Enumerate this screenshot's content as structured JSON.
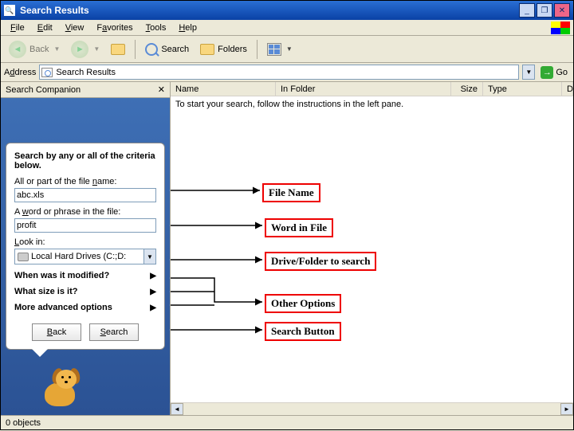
{
  "window": {
    "title": "Search Results"
  },
  "menu": {
    "file": "File",
    "edit": "Edit",
    "view": "View",
    "favorites": "Favorites",
    "tools": "Tools",
    "help": "Help"
  },
  "toolbar": {
    "back": "Back",
    "search": "Search",
    "folders": "Folders"
  },
  "address": {
    "label": "Address",
    "value": "Search Results",
    "go": "Go"
  },
  "companion": {
    "header": "Search Companion",
    "heading": "Search by any or all of the criteria below.",
    "filename_label": "All or part of the file name:",
    "filename_value": "abc.xls",
    "phrase_label": "A word or phrase in the file:",
    "phrase_value": "profit",
    "lookin_label": "Look in:",
    "lookin_value": "Local Hard Drives (C:;D:",
    "modified": "When was it modified?",
    "size": "What size is it?",
    "advanced": "More advanced options",
    "back_btn": "Back",
    "search_btn": "Search"
  },
  "columns": {
    "name": "Name",
    "infolder": "In Folder",
    "size": "Size",
    "type": "Type",
    "extra": "D"
  },
  "results": {
    "instruction": "To start your search, follow the instructions in the left pane."
  },
  "callouts": {
    "filename": "File Name",
    "word": "Word in File",
    "drive": "Drive/Folder to search",
    "other": "Other Options",
    "searchbtn": "Search Button"
  },
  "status": {
    "text": "0 objects"
  }
}
